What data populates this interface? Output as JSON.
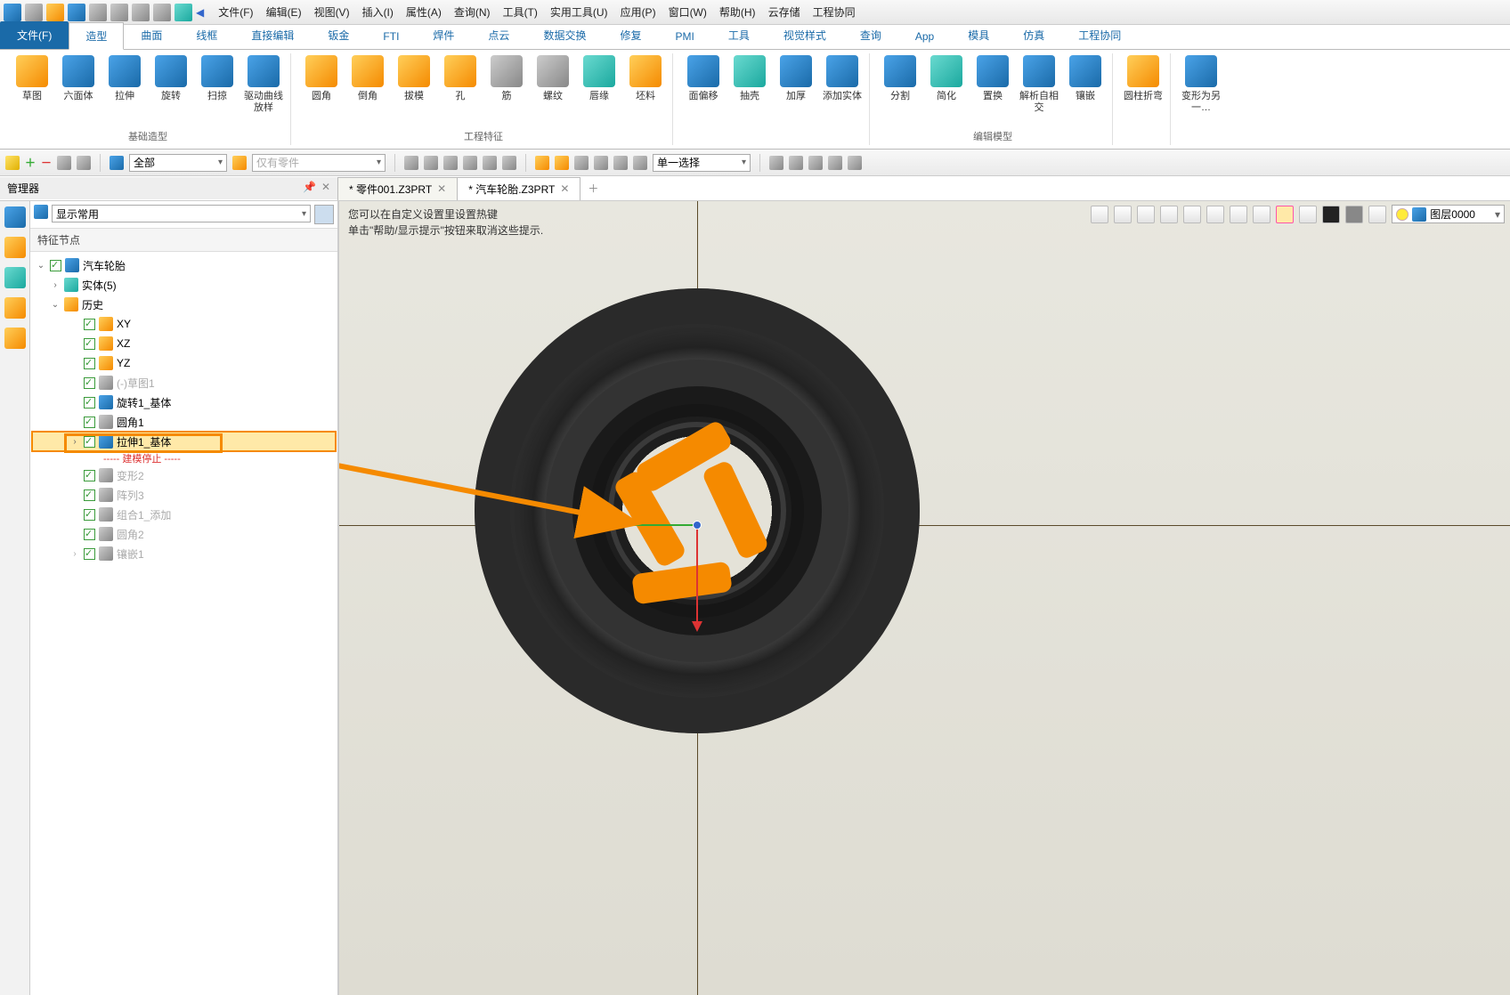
{
  "menus": [
    "文件(F)",
    "编辑(E)",
    "视图(V)",
    "插入(I)",
    "属性(A)",
    "查询(N)",
    "工具(T)",
    "实用工具(U)",
    "应用(P)",
    "窗口(W)",
    "帮助(H)",
    "云存储",
    "工程协同"
  ],
  "ribbon_tabs": [
    "文件(F)",
    "造型",
    "曲面",
    "线框",
    "直接编辑",
    "钣金",
    "FTI",
    "焊件",
    "点云",
    "数据交换",
    "修复",
    "PMI",
    "工具",
    "视觉样式",
    "查询",
    "App",
    "模具",
    "仿真",
    "工程协同"
  ],
  "ribbon_active": 0,
  "ribbon_selected": 1,
  "groups": [
    {
      "label": "基础造型",
      "items": [
        {
          "l": "草图",
          "c": "c-orange"
        },
        {
          "l": "六面体",
          "c": "c-blue"
        },
        {
          "l": "拉伸",
          "c": "c-blue"
        },
        {
          "l": "旋转",
          "c": "c-blue"
        },
        {
          "l": "扫掠",
          "c": "c-blue"
        },
        {
          "l": "驱动曲线放样",
          "c": "c-blue"
        }
      ]
    },
    {
      "label": "工程特征",
      "items": [
        {
          "l": "圆角",
          "c": "c-orange"
        },
        {
          "l": "倒角",
          "c": "c-orange"
        },
        {
          "l": "拔模",
          "c": "c-orange"
        },
        {
          "l": "孔",
          "c": "c-orange"
        },
        {
          "l": "筋",
          "c": "c-gray"
        },
        {
          "l": "螺纹",
          "c": "c-gray"
        },
        {
          "l": "唇缘",
          "c": "c-teal"
        },
        {
          "l": "坯料",
          "c": "c-orange"
        }
      ]
    },
    {
      "label": "",
      "items": [
        {
          "l": "面偏移",
          "c": "c-blue"
        },
        {
          "l": "抽壳",
          "c": "c-teal"
        },
        {
          "l": "加厚",
          "c": "c-blue"
        },
        {
          "l": "添加实体",
          "c": "c-blue"
        }
      ]
    },
    {
      "label": "编辑模型",
      "items": [
        {
          "l": "分割",
          "c": "c-blue"
        },
        {
          "l": "简化",
          "c": "c-teal"
        },
        {
          "l": "置换",
          "c": "c-blue"
        },
        {
          "l": "解析自相交",
          "c": "c-blue"
        },
        {
          "l": "镶嵌",
          "c": "c-blue"
        }
      ]
    },
    {
      "label": "",
      "items": [
        {
          "l": "圆柱折弯",
          "c": "c-orange"
        }
      ]
    },
    {
      "label": "",
      "items": [
        {
          "l": "变形为另一…",
          "c": "c-blue"
        }
      ]
    }
  ],
  "filter_all": "全部",
  "filter_parts": "仅有零件",
  "select_mode": "单一选择",
  "manager": "管理器",
  "show_common": "显示常用",
  "feature_nodes": "特征节点",
  "doc_tabs": [
    {
      "l": "* 零件001.Z3PRT",
      "active": false
    },
    {
      "l": "* 汽车轮胎.Z3PRT",
      "active": true
    }
  ],
  "tree": {
    "root": "汽车轮胎",
    "solids": "实体(5)",
    "history": "历史",
    "items": [
      {
        "l": "XY",
        "dim": false
      },
      {
        "l": "XZ",
        "dim": false
      },
      {
        "l": "YZ",
        "dim": false
      },
      {
        "l": "(-)草图1",
        "dim": true
      },
      {
        "l": "旋转1_基体",
        "dim": false
      },
      {
        "l": "圆角1",
        "dim": false
      },
      {
        "l": "拉伸1_基体",
        "dim": false,
        "hl": true,
        "exp": true
      },
      {
        "l": "----- 建模停止 -----",
        "stop": true
      },
      {
        "l": "变形2",
        "dim": true
      },
      {
        "l": "阵列3",
        "dim": true
      },
      {
        "l": "组合1_添加",
        "dim": true
      },
      {
        "l": "圆角2",
        "dim": true
      },
      {
        "l": "镶嵌1",
        "dim": true,
        "exp": true
      }
    ]
  },
  "hint1": "您可以在自定义设置里设置热键",
  "hint2": "单击\"帮助/显示提示\"按钮来取消这些提示.",
  "layer": "图层0000"
}
